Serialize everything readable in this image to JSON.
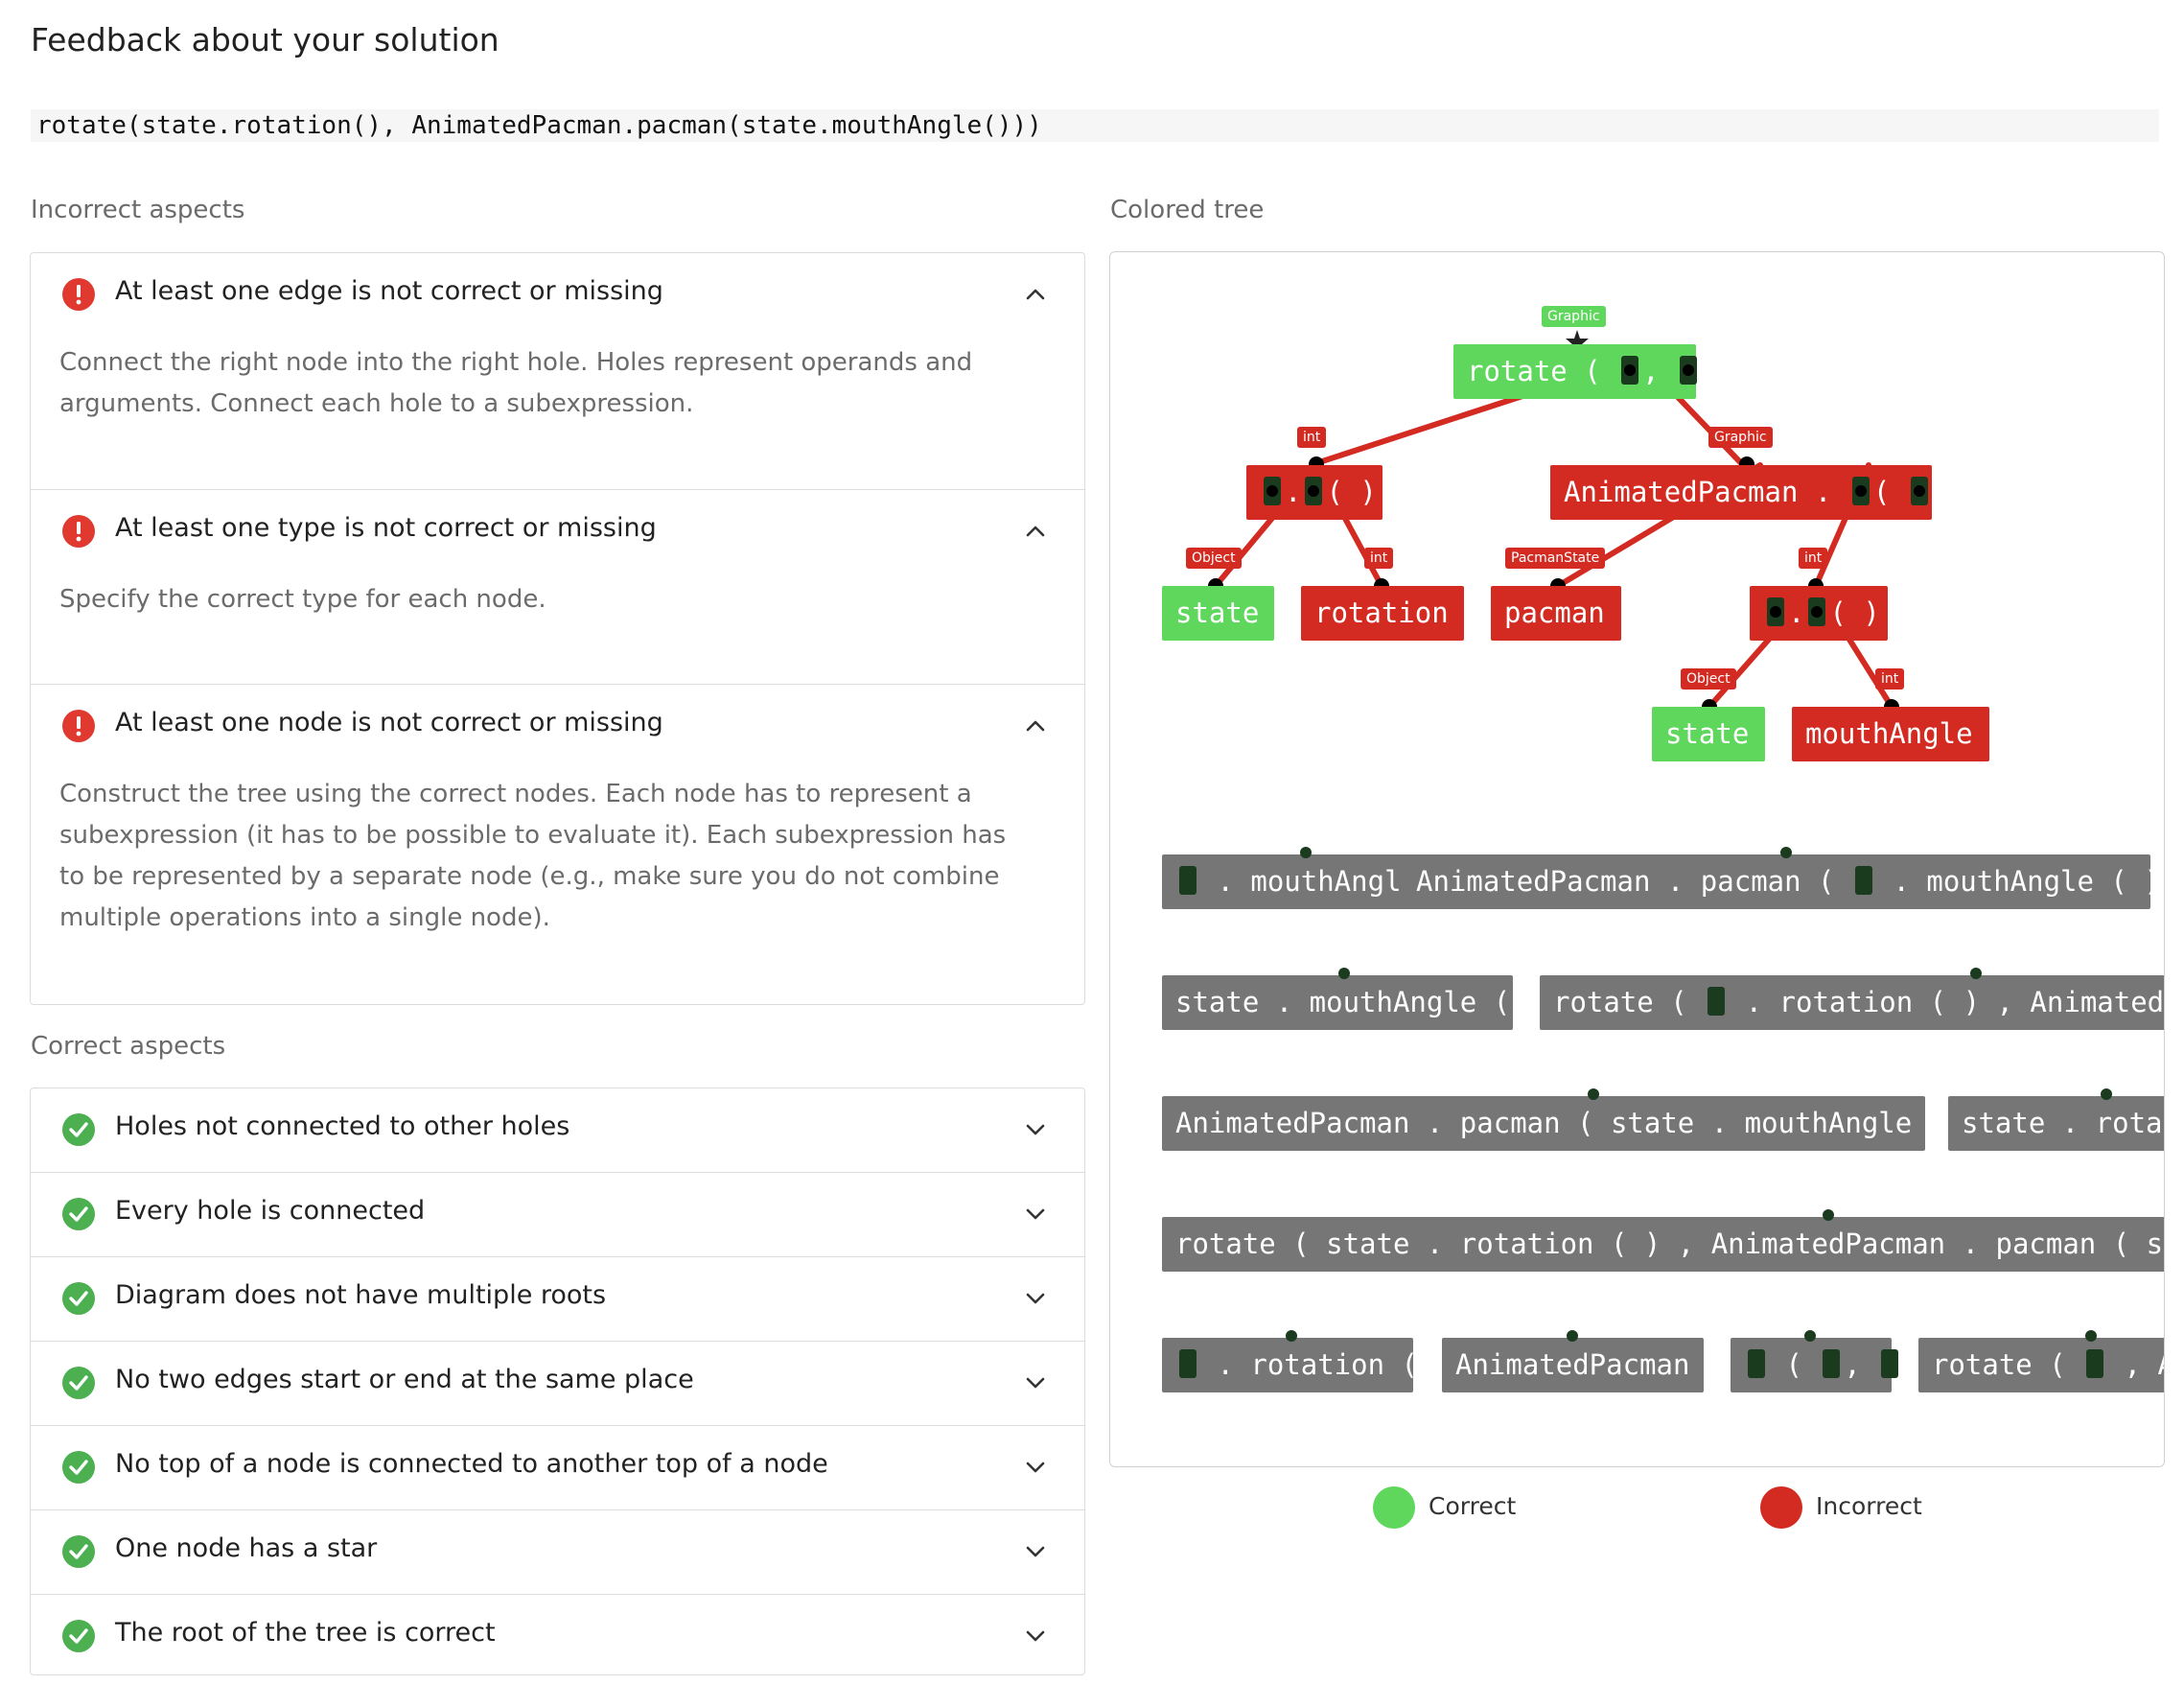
{
  "page_title": "Feedback about your solution",
  "code": "rotate(state.rotation(), AnimatedPacman.pacman(state.mouthAngle()))",
  "incorrect": {
    "title": "Incorrect aspects",
    "items": [
      {
        "title": "At least one edge is not correct or missing",
        "body": "Connect the right node into the right hole. Holes represent operands and arguments. Connect each hole to a subexpression."
      },
      {
        "title": "At least one type is not correct or missing",
        "body": "Specify the correct type for each node."
      },
      {
        "title": "At least one node is not correct or missing",
        "body": "Construct the tree using the correct nodes. Each node has to represent a subexpression (it has to be possible to evaluate it). Each subexpression has to be represented by a separate node (e.g., make sure you do not combine multiple operations into a single node)."
      }
    ]
  },
  "correct": {
    "title": "Correct aspects",
    "items": [
      "Holes not connected to other holes",
      "Every hole is connected",
      "Diagram does not have multiple roots",
      "No two edges start or end at the same place",
      "No top of a node is connected to another top of a node",
      "One node has a star",
      "The root of the tree is correct"
    ]
  },
  "tree": {
    "title": "Colored tree",
    "type_labels": {
      "root": "Graphic",
      "rotation_call": "int",
      "pacman_call": "Graphic",
      "state1": "Object",
      "rotation": "int",
      "pacman": "PacmanState",
      "mouth_call": "int",
      "state2": "Object",
      "mouthAngle": "int"
    },
    "nodes": {
      "root_name": "rotate",
      "state1": "state",
      "rotation": "rotation",
      "pacman_class": "AnimatedPacman",
      "pacman": "pacman",
      "state2": "state",
      "mouthAngle": "mouthAngle"
    },
    "palette": [
      {
        "prefix_hole": true,
        "text": ". mouthAngle ( )"
      },
      {
        "text": "AnimatedPacman . pacman (",
        "hole": true,
        "text2": ". mouthAngle ( ) )"
      },
      {
        "text": "state . mouthAngle ( )"
      },
      {
        "text": "rotate (",
        "hole": true,
        "text2": ". rotation ( ) , AnimatedPacman"
      },
      {
        "text": "AnimatedPacman . pacman ( state . mouthAngle ( ) )"
      },
      {
        "text": "state . rotat"
      },
      {
        "text": "rotate ( state . rotation ( ) , AnimatedPacman . pacman ( state . mou"
      },
      {
        "prefix_hole": true,
        "text": ". rotation ( )"
      },
      {
        "text": "AnimatedPacman"
      },
      {
        "text": "rotate (",
        "hole": true,
        "text2": ", Ani"
      }
    ]
  },
  "legend": {
    "correct": "Correct",
    "incorrect": "Incorrect"
  },
  "colors": {
    "correct": "#5fd75c",
    "incorrect": "#d32b22",
    "palette": "#767676",
    "error_icon": "#e0392f",
    "ok_icon": "#4caf50"
  }
}
